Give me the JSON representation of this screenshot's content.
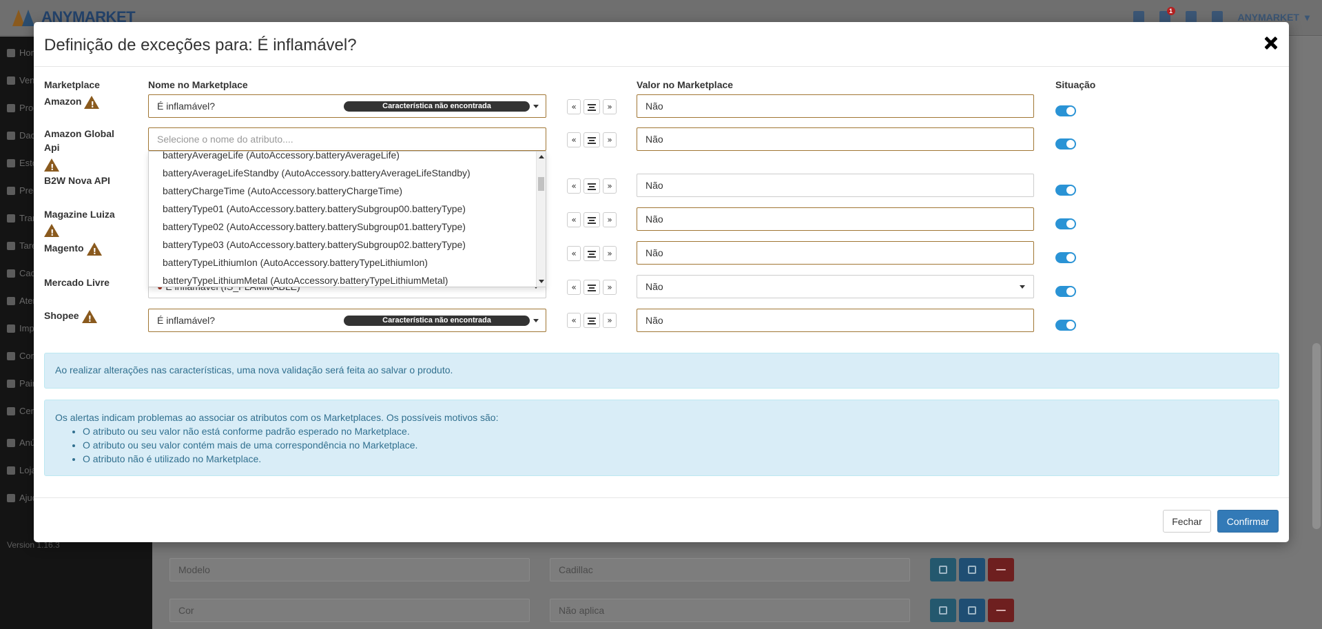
{
  "app": {
    "logo_text": "ANYMARKET",
    "topbar": {
      "notification_count": "1",
      "user_label": "ANYMARKET"
    },
    "sidebar": {
      "items": [
        {
          "label": "Home",
          "icon": "home-icon"
        },
        {
          "label": "Vendas",
          "icon": "chart-icon"
        },
        {
          "label": "Produtos",
          "icon": "product-icon"
        },
        {
          "label": "Dados",
          "icon": "dashboard-icon"
        },
        {
          "label": "Estoque",
          "icon": "stock-icon"
        },
        {
          "label": "Preços",
          "icon": "price-icon"
        },
        {
          "label": "Transmissões",
          "icon": "share-icon"
        },
        {
          "label": "Tarefas",
          "icon": "tasks-icon"
        },
        {
          "label": "Cadastros",
          "icon": "list-icon"
        },
        {
          "label": "Atendimento",
          "icon": "chat-icon"
        },
        {
          "label": "Importação",
          "icon": "cloud-icon"
        },
        {
          "label": "Configurações",
          "icon": "gear-icon"
        },
        {
          "label": "Painel",
          "icon": "monitor-icon"
        },
        {
          "label": "Central",
          "icon": "dial-icon"
        },
        {
          "label": "Anúncios",
          "icon": "star-icon"
        },
        {
          "label": "Loja",
          "icon": "grid-icon"
        },
        {
          "label": "Ajuda",
          "icon": "help-icon"
        }
      ],
      "version": "Version 1.16.3"
    },
    "background_rows": [
      {
        "name": "Modelo",
        "value": "Cadillac"
      },
      {
        "name": "Cor",
        "value": "Não aplica"
      }
    ]
  },
  "modal": {
    "title": "Definição de exceções para: É inflamável?",
    "columns": {
      "marketplace": "Marketplace",
      "name_in_marketplace": "Nome no Marketplace",
      "value_in_marketplace": "Valor no Marketplace",
      "situation": "Situação"
    },
    "rows": [
      {
        "marketplace": "Amazon",
        "warning": true,
        "attribute": "É inflamável?",
        "badge": "Característica não encontrada",
        "value": "Não",
        "active": true
      },
      {
        "marketplace": "Amazon Global Api",
        "warning": true,
        "attribute_placeholder": "Selecione o nome do atributo....",
        "value": "Não",
        "active": true
      },
      {
        "marketplace": "B2W Nova API",
        "warning": false,
        "value": "Não",
        "active": true
      },
      {
        "marketplace": "Magazine Luiza",
        "warning": true,
        "value": "Não",
        "active": true
      },
      {
        "marketplace": "Magento",
        "warning": true,
        "value": "Não",
        "active": true
      },
      {
        "marketplace": "Mercado Livre",
        "warning": false,
        "attribute": "É inflamável (IS_FLAMMABLE)",
        "value": "Não",
        "active": true
      },
      {
        "marketplace": "Shopee",
        "warning": true,
        "attribute": "É inflamável?",
        "badge": "Característica não encontrada",
        "value": "Não",
        "active": true
      }
    ],
    "dropdown_options": [
      "batteryAverageLife (AutoAccessory.batteryAverageLife)",
      "batteryAverageLifeStandby (AutoAccessory.batteryAverageLifeStandby)",
      "batteryChargeTime (AutoAccessory.batteryChargeTime)",
      "batteryType01 (AutoAccessory.battery.batterySubgroup00.batteryType)",
      "batteryType02 (AutoAccessory.battery.batterySubgroup01.batteryType)",
      "batteryType03 (AutoAccessory.battery.batterySubgroup02.batteryType)",
      "batteryTypeLithiumIon (AutoAccessory.batteryTypeLithiumIon)",
      "batteryTypeLithiumMetal (AutoAccessory.batteryTypeLithiumMetal)"
    ],
    "arrows": {
      "left": "«",
      "right": "»"
    },
    "info_alert": "Ao realizar alterações nas características, uma nova validação será feita ao salvar o produto.",
    "warning_alert": {
      "intro": "Os alertas indicam problemas ao associar os atributos com os Marketplaces. Os possíveis motivos são:",
      "reasons": [
        "O atributo ou seu valor não está conforme padrão esperado no Marketplace.",
        "O atributo ou seu valor contém mais de uma correspondência no Marketplace.",
        "O atributo não é utilizado no Marketplace."
      ]
    },
    "buttons": {
      "close": "Fechar",
      "confirm": "Confirmar"
    }
  },
  "colors": {
    "warning_accent": "#8a5a1e",
    "toggle_on": "#2a93d5",
    "primary_button": "#337ab7",
    "alert_bg": "#d9edf7",
    "alert_text": "#31708f"
  }
}
